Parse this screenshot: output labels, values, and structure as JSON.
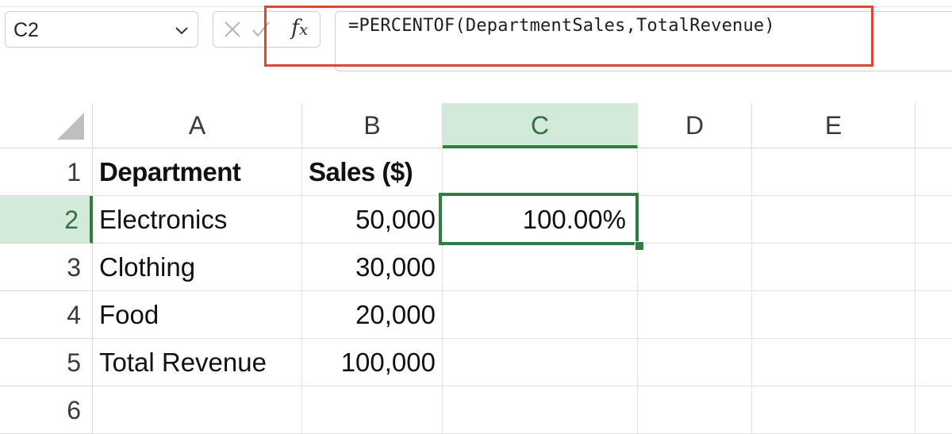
{
  "name_box": {
    "value": "C2"
  },
  "formula_bar": {
    "cancel_icon": "cancel-x-icon",
    "enter_icon": "enter-check-icon",
    "fx_label": "fx",
    "formula": "=PERCENTOF(DepartmentSales,TotalRevenue)",
    "highlight_color": "#e0452f"
  },
  "columns": [
    "A",
    "B",
    "C",
    "D",
    "E"
  ],
  "rows": [
    "1",
    "2",
    "3",
    "4",
    "5",
    "6"
  ],
  "selected": {
    "column": "C",
    "row": "2",
    "accent": "#2f7d45",
    "header_fill": "#d3eadb"
  },
  "cells": {
    "A1": "Department",
    "B1": "Sales ($)",
    "A2": "Electronics",
    "B2": "50,000",
    "C2": "100.00%",
    "A3": "Clothing",
    "B3": "30,000",
    "A4": "Food",
    "B4": "20,000",
    "A5": "Total Revenue",
    "B5": "100,000"
  }
}
